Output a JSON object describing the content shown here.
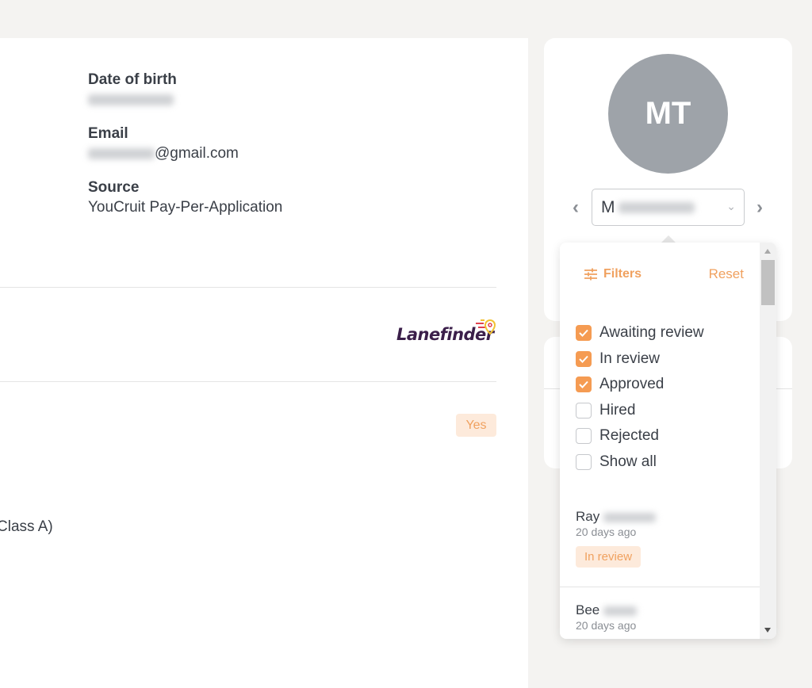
{
  "details": {
    "dob": {
      "label": "Date of birth",
      "value": ""
    },
    "email": {
      "label": "Email",
      "value_suffix": "@gmail.com"
    },
    "source": {
      "label": "Source",
      "value": "YouCruit Pay-Per-Application"
    }
  },
  "company": {
    "logo_text": "Lanefinder"
  },
  "answer_badge": "Yes",
  "license_text": "Class A)",
  "profile": {
    "initials": "MT",
    "selected_candidate_prefix": "M",
    "prev_icon": "‹",
    "next_icon": "›"
  },
  "dropdown": {
    "filters_label": "Filters",
    "reset_label": "Reset",
    "filters": [
      {
        "label": "Awaiting review",
        "checked": true
      },
      {
        "label": "In review",
        "checked": true
      },
      {
        "label": "Approved",
        "checked": true
      },
      {
        "label": "Hired",
        "checked": false
      },
      {
        "label": "Rejected",
        "checked": false
      },
      {
        "label": "Show all",
        "checked": false
      }
    ],
    "candidates": [
      {
        "first_name": "Ray",
        "time": "20 days ago",
        "status": "In review"
      },
      {
        "first_name": "Bee",
        "time": "20 days ago"
      }
    ]
  },
  "colors": {
    "accent": "#f59b52",
    "badge_bg": "#fdeadb",
    "avatar_bg": "#9ea3a9"
  }
}
